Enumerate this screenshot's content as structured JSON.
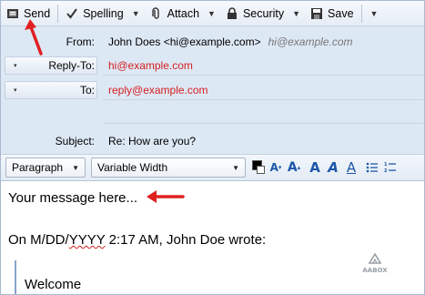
{
  "toolbar": {
    "send_label": "Send",
    "spelling_label": "Spelling",
    "attach_label": "Attach",
    "security_label": "Security",
    "save_label": "Save"
  },
  "headers": {
    "from_label": "From:",
    "from_value": "John Does <hi@example.com>",
    "from_hint": "hi@example.com",
    "replyto_label": "Reply-To:",
    "replyto_value": "hi@example.com",
    "to_label": "To:",
    "to_value": "reply@example.com",
    "subject_label": "Subject:",
    "subject_value": "Re: How are you?"
  },
  "format": {
    "paragraph_style": "Paragraph",
    "font": "Variable Width",
    "text_color": "#000000"
  },
  "body": {
    "message": "Your message here...",
    "reply_header_prefix": "On M/DD/",
    "reply_header_year": "YYYY",
    "reply_header_suffix": " 2:17 AM, John Doe wrote:",
    "quoted_text": "Welcome",
    "logo_text": "AABOX"
  },
  "colors": {
    "annotation_arrow": "#e02020",
    "header_background": "#dde8f5",
    "address_text": "#d42020"
  }
}
